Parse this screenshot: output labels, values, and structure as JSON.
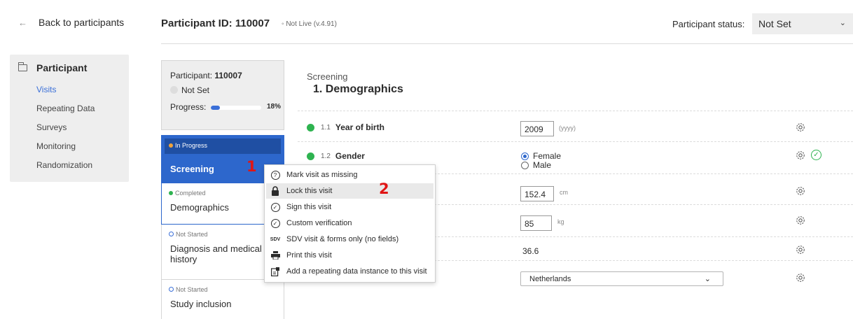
{
  "sidebar": {
    "back_label": "Back to participants",
    "section_label": "Participant",
    "items": [
      {
        "label": "Visits",
        "active": true
      },
      {
        "label": "Repeating Data"
      },
      {
        "label": "Surveys"
      },
      {
        "label": "Monitoring"
      },
      {
        "label": "Randomization"
      }
    ]
  },
  "header": {
    "title": "Participant ID: 110007",
    "live_status": "◦ Not Live (v.4.91)",
    "status_label": "Participant status:",
    "status_value": "Not Set"
  },
  "participant_card": {
    "participant_prefix": "Participant:",
    "participant_id": "110007",
    "status": "Not Set",
    "progress_label": "Progress:",
    "progress_value": 18,
    "progress_text": "18%"
  },
  "visits": [
    {
      "status": "In Progress",
      "name": "Screening"
    },
    {
      "status": "Completed",
      "name": "Demographics"
    },
    {
      "status": "Not Started",
      "name": "Diagnosis and medical history"
    },
    {
      "status": "Not Started",
      "name": "Study inclusion"
    }
  ],
  "form": {
    "crumb": "Screening",
    "title": "1. Demographics",
    "q1": {
      "num": "1.1",
      "label": "Year of birth",
      "value": "2009",
      "unit": "(yyyy)"
    },
    "q2": {
      "num": "1.2",
      "label": "Gender",
      "options": [
        "Female",
        "Male"
      ],
      "selected": "Female"
    },
    "height": {
      "value": "152.4",
      "unit": "cm"
    },
    "weight": {
      "value": "85",
      "unit": "kg"
    },
    "calculated": "36.6",
    "country": "Netherlands"
  },
  "context_menu": {
    "items": [
      {
        "label": "Mark visit as missing",
        "icon": "clock-question-icon"
      },
      {
        "label": "Lock this visit",
        "icon": "lock-icon"
      },
      {
        "label": "Sign this visit",
        "icon": "check-circle-icon"
      },
      {
        "label": "Custom verification",
        "icon": "check-circle-icon"
      },
      {
        "label": "SDV visit & forms only (no fields)",
        "icon": "sdv-icon"
      },
      {
        "label": "Print this visit",
        "icon": "printer-icon"
      },
      {
        "label": "Add a repeating data instance to this visit",
        "icon": "add-document-icon"
      }
    ],
    "highlighted_index": 1
  },
  "annotations": [
    "1",
    "2"
  ],
  "colors": {
    "accent": "#2d67cc",
    "success": "#2eb350",
    "annotation": "#e01515",
    "warning": "#f0a33a"
  }
}
